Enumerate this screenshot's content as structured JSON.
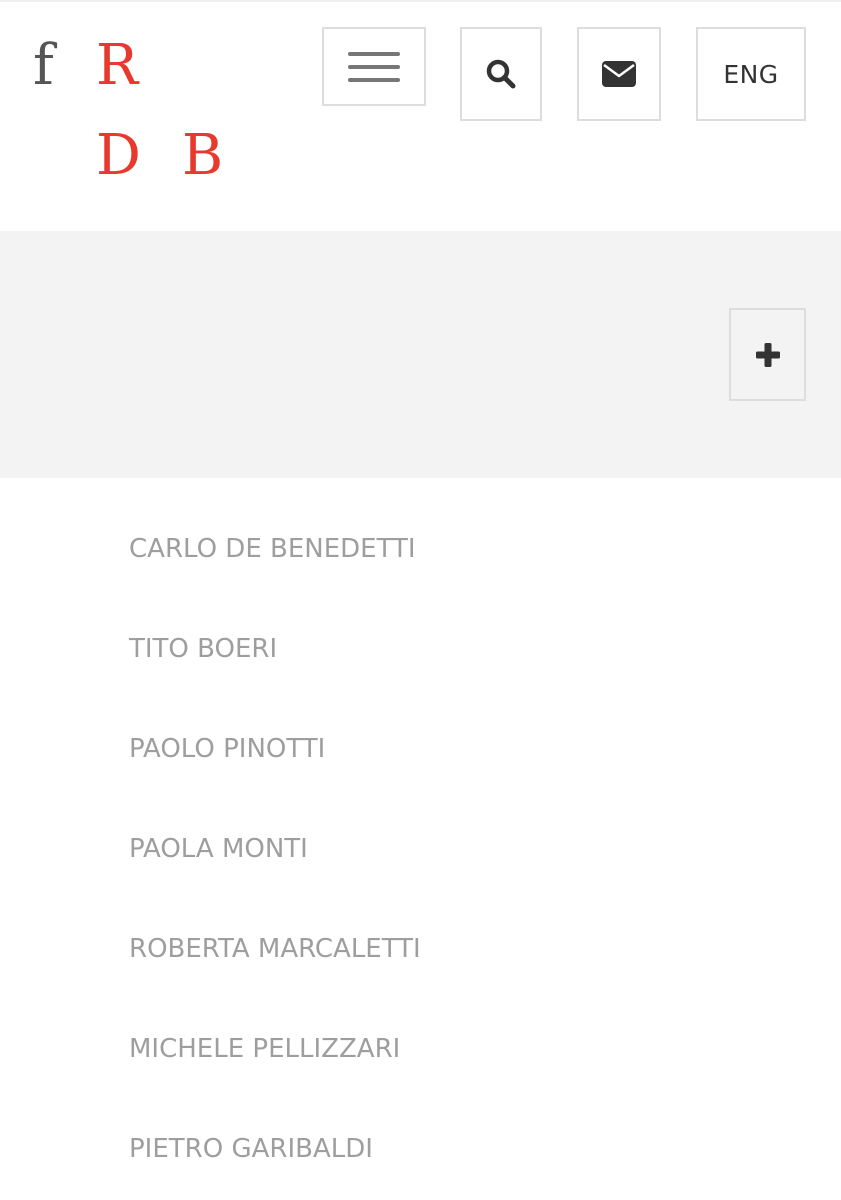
{
  "logo": {
    "letter_f": "f",
    "letter_r": "R",
    "letter_d": "D",
    "letter_b": "B",
    "colors": {
      "accent": "#e8392d",
      "f": "#555555"
    }
  },
  "header": {
    "menu_icon": "hamburger-icon",
    "search_icon": "search-icon",
    "mail_icon": "mail-icon",
    "lang_label": "ENG"
  },
  "band": {
    "expand_icon": "plus-icon",
    "background": "#f3f3f3"
  },
  "people": [
    "CARLO DE BENEDETTI",
    "TITO BOERI",
    "PAOLO PINOTTI",
    "PAOLA MONTI",
    "ROBERTA MARCALETTI",
    "MICHELE PELLIZZARI",
    "PIETRO GARIBALDI"
  ],
  "colors": {
    "list_text": "#9e9e9e",
    "button_border": "#dddddd",
    "icon": "#333333"
  }
}
